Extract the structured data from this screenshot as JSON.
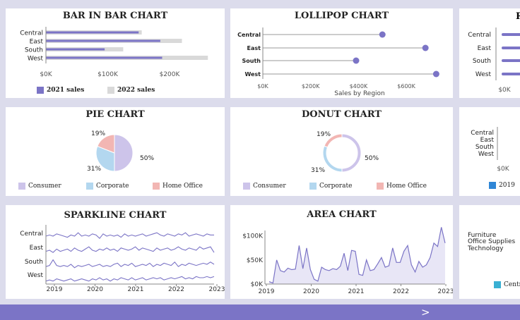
{
  "colors": {
    "primary": "#7b74c6",
    "light_gray": "#d9d9d9",
    "consumer": "#cdc4ea",
    "corporate": "#b3d7ef",
    "home_office": "#f2b6b3",
    "blue_2019": "#2f86d6",
    "teal": "#3ab0d3",
    "area_fill": "#e8e6f6"
  },
  "regions": [
    "Central",
    "East",
    "South",
    "West"
  ],
  "bar_in_bar": {
    "title": "BAR IN BAR CHART",
    "legend": {
      "a": "2021 sales",
      "b": "2022 sales"
    },
    "ticks": [
      "$0K",
      "$100K",
      "$200K"
    ]
  },
  "lollipop": {
    "title": "LOLLIPOP CHART",
    "ticks": [
      "$0K",
      "$200K",
      "$400K",
      "$600K"
    ],
    "xlabel": "Sales by Region"
  },
  "third_card": {
    "title_fragment": "R",
    "ticks": [
      "$0K"
    ]
  },
  "pie": {
    "title": "PIE CHART",
    "labels": {
      "consumer": "50%",
      "corporate": "31%",
      "home_office": "19%"
    }
  },
  "donut": {
    "title": "DONUT CHART",
    "labels": {
      "consumer": "50%",
      "corporate": "31%",
      "home_office": "19%"
    }
  },
  "segments": {
    "consumer": "Consumer",
    "corporate": "Corporate",
    "home_office": "Home Office"
  },
  "sixth_card": {
    "ticks": [
      "$0K"
    ],
    "legend": "2019"
  },
  "sparkline": {
    "title": "SPARKLINE CHART",
    "years": [
      "2019",
      "2020",
      "2021",
      "2022",
      "2023"
    ]
  },
  "area": {
    "title": "AREA CHART",
    "yticks": [
      "$100K",
      "$50K",
      "$0K"
    ],
    "years": [
      "2019",
      "2020",
      "2021",
      "2022",
      "2023"
    ]
  },
  "ninth_card": {
    "categories": [
      "Furniture",
      "Office Supplies",
      "Technology"
    ],
    "legend": "Centr"
  },
  "nav": {
    "next_label": ">"
  },
  "chart_data": [
    {
      "type": "bar",
      "title": "BAR IN BAR CHART",
      "categories": [
        "Central",
        "East",
        "South",
        "West"
      ],
      "series": [
        {
          "name": "2021 sales",
          "values": [
            150000,
            185000,
            95000,
            188000
          ]
        },
        {
          "name": "2022 sales",
          "values": [
            155000,
            220000,
            125000,
            262000
          ]
        }
      ],
      "ticks": [
        "$0K",
        "$100K",
        "$200K"
      ],
      "xlim": [
        0,
        280000
      ]
    },
    {
      "type": "scatter",
      "title": "LOLLIPOP CHART",
      "categories": [
        "Central",
        "East",
        "South",
        "West"
      ],
      "values": [
        500000,
        680000,
        390000,
        725000
      ],
      "ticks": [
        "$0K",
        "$200K",
        "$400K",
        "$600K"
      ],
      "xlabel": "Sales by Region",
      "xlim": [
        0,
        780000
      ]
    },
    {
      "type": "pie",
      "title": "PIE CHART",
      "labels": [
        "Consumer",
        "Corporate",
        "Home Office"
      ],
      "values": [
        50,
        31,
        19
      ]
    },
    {
      "type": "pie",
      "title": "DONUT CHART",
      "labels": [
        "Consumer",
        "Corporate",
        "Home Office"
      ],
      "values": [
        50,
        31,
        19
      ]
    },
    {
      "type": "line",
      "title": "SPARKLINE CHART",
      "x_range": [
        "2019",
        "2023"
      ],
      "series": [
        {
          "name": "Central",
          "values": [
            5,
            6,
            5,
            7,
            6,
            5,
            4,
            6,
            5,
            8,
            5,
            6,
            5,
            7,
            6,
            3,
            7,
            5,
            6,
            5,
            6,
            4,
            7,
            5,
            6,
            5,
            6,
            7,
            5,
            6,
            7,
            8,
            6,
            5,
            7,
            6,
            5,
            7,
            6,
            8,
            5,
            6,
            7,
            6,
            5,
            7,
            6,
            6
          ]
        },
        {
          "name": "East",
          "values": [
            4,
            5,
            3,
            6,
            4,
            5,
            6,
            4,
            7,
            5,
            4,
            6,
            8,
            5,
            4,
            6,
            5,
            7,
            5,
            6,
            4,
            7,
            6,
            5,
            6,
            8,
            5,
            7,
            6,
            5,
            4,
            7,
            5,
            6,
            7,
            5,
            6,
            8,
            6,
            5,
            7,
            6,
            5,
            8,
            6,
            7,
            8,
            3
          ]
        },
        {
          "name": "South",
          "values": [
            3,
            4,
            9,
            4,
            3,
            4,
            3,
            5,
            2,
            4,
            3,
            4,
            5,
            3,
            4,
            5,
            3,
            4,
            3,
            5,
            6,
            3,
            5,
            4,
            6,
            3,
            4,
            5,
            4,
            6,
            3,
            5,
            4,
            6,
            5,
            4,
            7,
            3,
            5,
            4,
            6,
            5,
            4,
            5,
            6,
            5,
            7,
            5
          ]
        },
        {
          "name": "West",
          "values": [
            2,
            3,
            2,
            4,
            3,
            2,
            3,
            4,
            2,
            3,
            4,
            3,
            2,
            4,
            3,
            5,
            3,
            4,
            2,
            4,
            3,
            5,
            4,
            3,
            5,
            3,
            4,
            5,
            3,
            4,
            5,
            4,
            5,
            3,
            4,
            5,
            4,
            5,
            6,
            4,
            5,
            4,
            6,
            5,
            5,
            6,
            5,
            6
          ]
        }
      ]
    },
    {
      "type": "area",
      "title": "AREA CHART",
      "x_range": [
        "2019",
        "2023"
      ],
      "ylim": [
        0,
        120000
      ],
      "yticks": [
        "$100K",
        "$50K",
        "$0K"
      ],
      "values": [
        5000,
        2000,
        50000,
        28000,
        25000,
        33000,
        30000,
        31000,
        80000,
        32000,
        75000,
        30000,
        10000,
        6000,
        35000,
        30000,
        28000,
        32000,
        30000,
        37000,
        64000,
        28000,
        70000,
        68000,
        20000,
        18000,
        50000,
        28000,
        30000,
        42000,
        55000,
        35000,
        38000,
        75000,
        45000,
        45000,
        68000,
        80000,
        40000,
        25000,
        47000,
        35000,
        40000,
        55000,
        85000,
        78000,
        118000,
        85000
      ]
    }
  ]
}
